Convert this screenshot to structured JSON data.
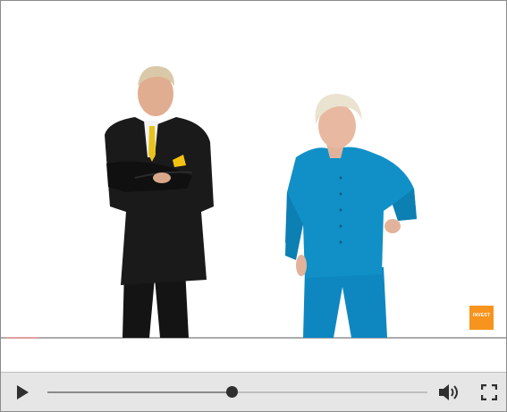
{
  "player": {
    "progress_fraction": 0.484,
    "buffer_fraction": 0.0,
    "logo_text_line1": "INVEST",
    "logo_text_line2": "",
    "accent_color": "#f7941d",
    "icons": {
      "play": "play-icon",
      "volume": "volume-icon",
      "fullscreen": "fullscreen-icon"
    }
  }
}
